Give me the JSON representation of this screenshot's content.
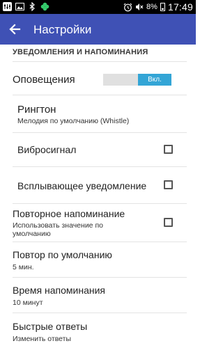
{
  "status_bar": {
    "icons_left": [
      "settings-sliders-icon",
      "image-icon",
      "bluetooth-icon",
      "clover-icon"
    ],
    "icons_right": [
      "alarm-icon",
      "mute-icon",
      "battery-icon"
    ],
    "battery": "8%",
    "time": "17:49"
  },
  "appbar": {
    "title": "Настройки",
    "color": "#3f51b5"
  },
  "section": {
    "header": "УВЕДОМЛЕНИЯ И НАПОМИНАНИЯ"
  },
  "settings": {
    "notifications": {
      "title": "Оповещения",
      "switch_label": "Вкл.",
      "enabled": true
    },
    "ringtone": {
      "title": "Рингтон",
      "subtitle": "Мелодия по умолчанию (Whistle)"
    },
    "vibration": {
      "title": "Вибросигнал",
      "checked": false
    },
    "popup": {
      "title": "Всплывающее уведомление",
      "checked": false
    },
    "repeat_reminder": {
      "title": "Повторное напоминание",
      "subtitle_line1": "Использовать значение по",
      "subtitle_line2": "умолчанию",
      "checked": false
    },
    "default_repeat": {
      "title": "Повтор по умолчанию",
      "subtitle": "5 мин."
    },
    "reminder_time": {
      "title": "Время напоминания",
      "subtitle": "10 минут"
    },
    "quick_replies": {
      "title": "Быстрые ответы",
      "subtitle": "Изменить ответы"
    }
  }
}
